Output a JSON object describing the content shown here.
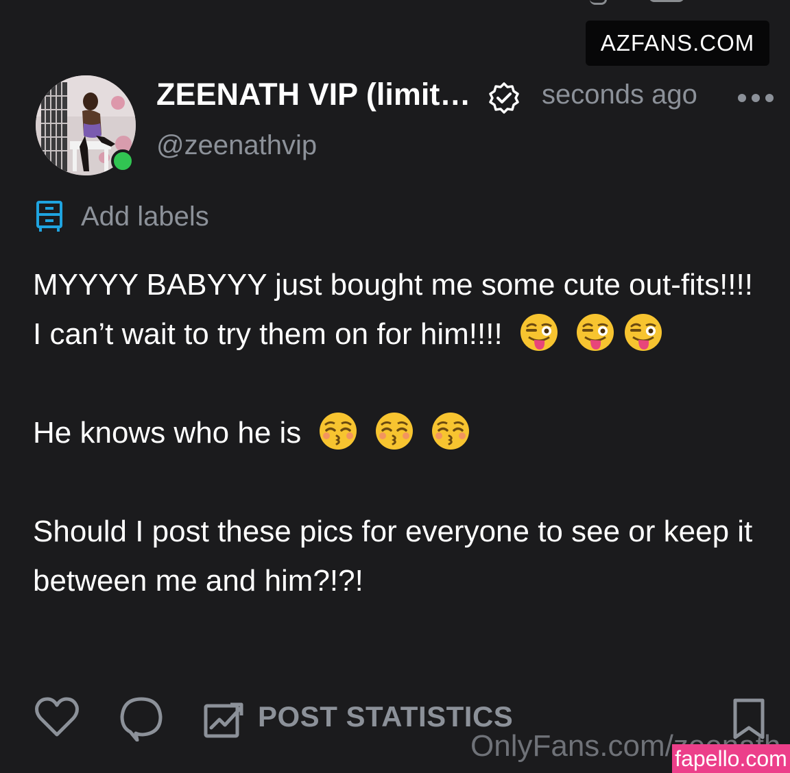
{
  "watermarks": {
    "top_right": "AZFANS.COM",
    "bottom": "OnlyFans.com/zeenath",
    "corner": "fapello.com"
  },
  "post_header": {
    "display_name": "ZEENATH VIP (limit…",
    "handle": "@zeenathvip",
    "timestamp": "seconds ago",
    "verified_icon": "verified-badge-icon",
    "more_icon": "more-options-icon",
    "online_status_color": "#31c552"
  },
  "labels": {
    "text": "Add labels",
    "icon": "labels-icon",
    "icon_color": "#1fa4e0"
  },
  "post_body": {
    "paragraph_1": "MYYYY BABYYY just bought me some cute out-fits!!!! I can’t wait to try them on for him!!!!",
    "paragraph_1_emojis": [
      "😜",
      "😜",
      "😜"
    ],
    "paragraph_2": "He knows who he is",
    "paragraph_2_emojis": [
      "😚",
      "😚",
      "😚"
    ],
    "paragraph_3": "Should I post these pics for everyone to see or keep it between me and him?!?!"
  },
  "actions": {
    "like_icon": "heart-icon",
    "comment_icon": "comment-icon",
    "stats_icon": "chart-icon",
    "stats_label": "POST STATISTICS",
    "bookmark_icon": "bookmark-icon"
  },
  "colors": {
    "background": "#1b1b1d",
    "muted_text": "#8c9199",
    "fapello_badge": "#ec3f8a"
  }
}
